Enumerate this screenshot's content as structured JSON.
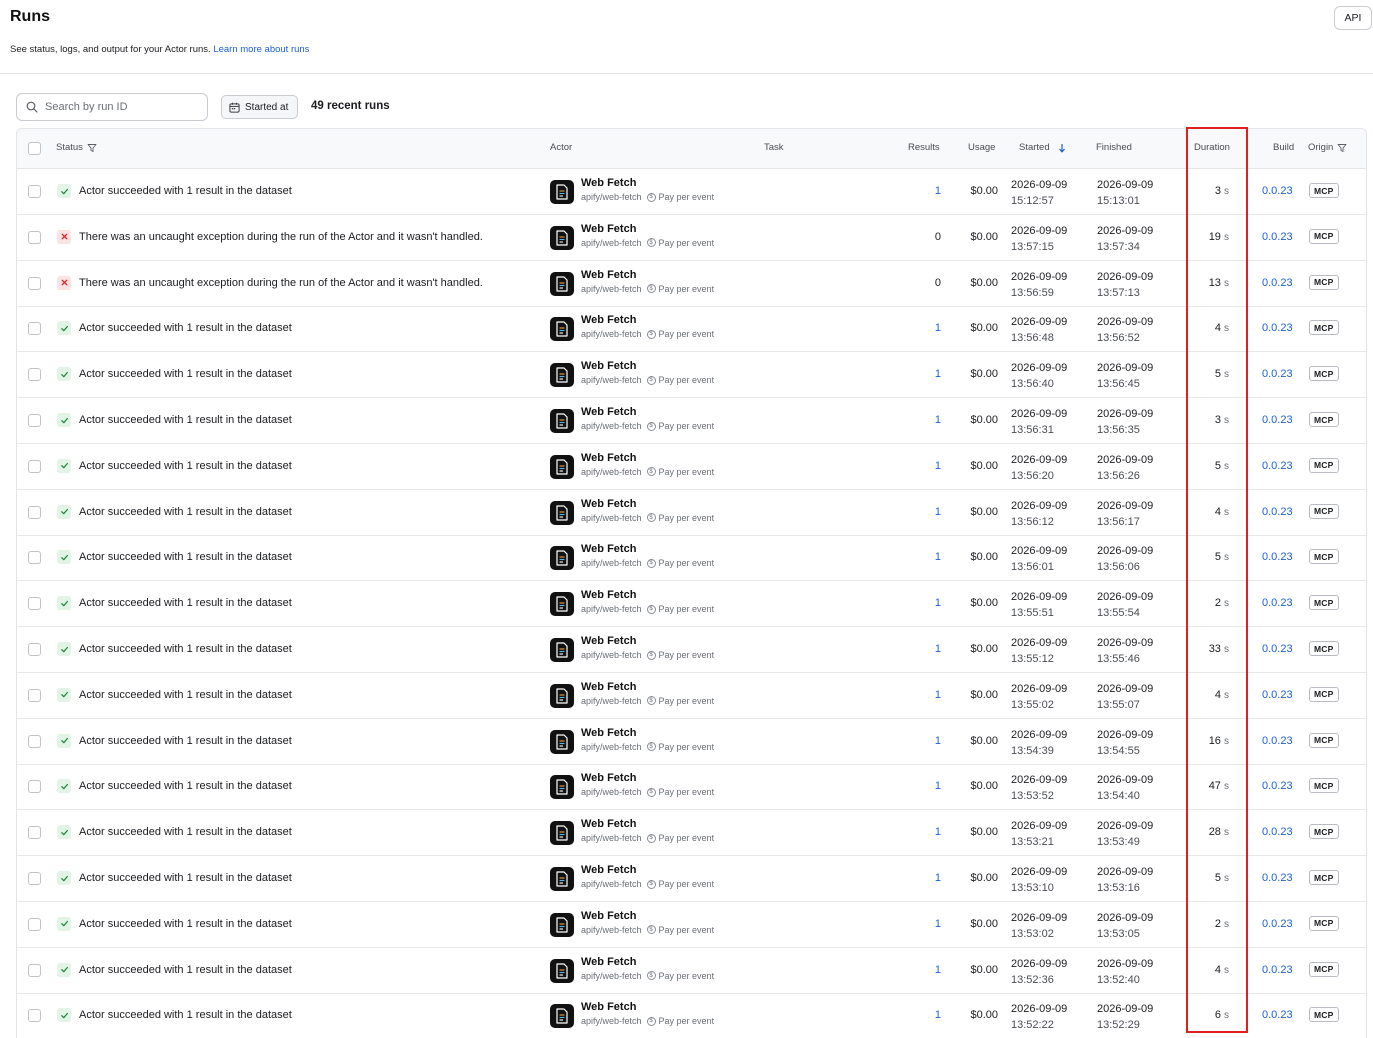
{
  "page": {
    "title": "Runs",
    "subtitle": "See status, logs, and output for your Actor runs.",
    "learn_more": "Learn more about runs",
    "api_label": "API"
  },
  "toolbar": {
    "search_placeholder": "Search by run ID",
    "date_filter_label": "Started at",
    "runs_count": "49 recent runs"
  },
  "columns": {
    "status": "Status",
    "actor": "Actor",
    "task": "Task",
    "results": "Results",
    "usage": "Usage",
    "started": "Started",
    "finished": "Finished",
    "duration": "Duration",
    "build": "Build",
    "origin": "Origin"
  },
  "icons": {
    "search": "search-icon",
    "calendar": "calendar-icon",
    "filter": "filter-icon",
    "sort": "sort-down-arrow-icon",
    "success": "check-icon",
    "failure": "x-icon",
    "actor": "document-icon",
    "pricing": "coin-icon"
  },
  "colors": {
    "link": "#1c5fd6",
    "success_bg": "#e1f4e5",
    "success_fg": "#1f8a3d",
    "error_bg": "#fbe3e3",
    "error_fg": "#d42a2a",
    "highlight": "#e02020"
  },
  "runs": [
    {
      "status": "success",
      "status_text": "Actor succeeded with 1 result in the dataset",
      "actor_name": "Web Fetch",
      "actor_slug": "apify/web-fetch",
      "pricing": "Pay per event",
      "results": "1",
      "usage": "$0.00",
      "started_date": "2026-09-09",
      "started_time": "15:12:57",
      "finished_date": "2026-09-09",
      "finished_time": "15:13:01",
      "duration": "3",
      "duration_unit": "s",
      "build": "0.0.23",
      "origin": "MCP"
    },
    {
      "status": "failed",
      "status_text": "There was an uncaught exception during the run of the Actor and it wasn't handled.",
      "actor_name": "Web Fetch",
      "actor_slug": "apify/web-fetch",
      "pricing": "Pay per event",
      "results": "0",
      "usage": "$0.00",
      "started_date": "2026-09-09",
      "started_time": "13:57:15",
      "finished_date": "2026-09-09",
      "finished_time": "13:57:34",
      "duration": "19",
      "duration_unit": "s",
      "build": "0.0.23",
      "origin": "MCP"
    },
    {
      "status": "failed",
      "status_text": "There was an uncaught exception during the run of the Actor and it wasn't handled.",
      "actor_name": "Web Fetch",
      "actor_slug": "apify/web-fetch",
      "pricing": "Pay per event",
      "results": "0",
      "usage": "$0.00",
      "started_date": "2026-09-09",
      "started_time": "13:56:59",
      "finished_date": "2026-09-09",
      "finished_time": "13:57:13",
      "duration": "13",
      "duration_unit": "s",
      "build": "0.0.23",
      "origin": "MCP"
    },
    {
      "status": "success",
      "status_text": "Actor succeeded with 1 result in the dataset",
      "actor_name": "Web Fetch",
      "actor_slug": "apify/web-fetch",
      "pricing": "Pay per event",
      "results": "1",
      "usage": "$0.00",
      "started_date": "2026-09-09",
      "started_time": "13:56:48",
      "finished_date": "2026-09-09",
      "finished_time": "13:56:52",
      "duration": "4",
      "duration_unit": "s",
      "build": "0.0.23",
      "origin": "MCP"
    },
    {
      "status": "success",
      "status_text": "Actor succeeded with 1 result in the dataset",
      "actor_name": "Web Fetch",
      "actor_slug": "apify/web-fetch",
      "pricing": "Pay per event",
      "results": "1",
      "usage": "$0.00",
      "started_date": "2026-09-09",
      "started_time": "13:56:40",
      "finished_date": "2026-09-09",
      "finished_time": "13:56:45",
      "duration": "5",
      "duration_unit": "s",
      "build": "0.0.23",
      "origin": "MCP"
    },
    {
      "status": "success",
      "status_text": "Actor succeeded with 1 result in the dataset",
      "actor_name": "Web Fetch",
      "actor_slug": "apify/web-fetch",
      "pricing": "Pay per event",
      "results": "1",
      "usage": "$0.00",
      "started_date": "2026-09-09",
      "started_time": "13:56:31",
      "finished_date": "2026-09-09",
      "finished_time": "13:56:35",
      "duration": "3",
      "duration_unit": "s",
      "build": "0.0.23",
      "origin": "MCP"
    },
    {
      "status": "success",
      "status_text": "Actor succeeded with 1 result in the dataset",
      "actor_name": "Web Fetch",
      "actor_slug": "apify/web-fetch",
      "pricing": "Pay per event",
      "results": "1",
      "usage": "$0.00",
      "started_date": "2026-09-09",
      "started_time": "13:56:20",
      "finished_date": "2026-09-09",
      "finished_time": "13:56:26",
      "duration": "5",
      "duration_unit": "s",
      "build": "0.0.23",
      "origin": "MCP"
    },
    {
      "status": "success",
      "status_text": "Actor succeeded with 1 result in the dataset",
      "actor_name": "Web Fetch",
      "actor_slug": "apify/web-fetch",
      "pricing": "Pay per event",
      "results": "1",
      "usage": "$0.00",
      "started_date": "2026-09-09",
      "started_time": "13:56:12",
      "finished_date": "2026-09-09",
      "finished_time": "13:56:17",
      "duration": "4",
      "duration_unit": "s",
      "build": "0.0.23",
      "origin": "MCP"
    },
    {
      "status": "success",
      "status_text": "Actor succeeded with 1 result in the dataset",
      "actor_name": "Web Fetch",
      "actor_slug": "apify/web-fetch",
      "pricing": "Pay per event",
      "results": "1",
      "usage": "$0.00",
      "started_date": "2026-09-09",
      "started_time": "13:56:01",
      "finished_date": "2026-09-09",
      "finished_time": "13:56:06",
      "duration": "5",
      "duration_unit": "s",
      "build": "0.0.23",
      "origin": "MCP"
    },
    {
      "status": "success",
      "status_text": "Actor succeeded with 1 result in the dataset",
      "actor_name": "Web Fetch",
      "actor_slug": "apify/web-fetch",
      "pricing": "Pay per event",
      "results": "1",
      "usage": "$0.00",
      "started_date": "2026-09-09",
      "started_time": "13:55:51",
      "finished_date": "2026-09-09",
      "finished_time": "13:55:54",
      "duration": "2",
      "duration_unit": "s",
      "build": "0.0.23",
      "origin": "MCP"
    },
    {
      "status": "success",
      "status_text": "Actor succeeded with 1 result in the dataset",
      "actor_name": "Web Fetch",
      "actor_slug": "apify/web-fetch",
      "pricing": "Pay per event",
      "results": "1",
      "usage": "$0.00",
      "started_date": "2026-09-09",
      "started_time": "13:55:12",
      "finished_date": "2026-09-09",
      "finished_time": "13:55:46",
      "duration": "33",
      "duration_unit": "s",
      "build": "0.0.23",
      "origin": "MCP"
    },
    {
      "status": "success",
      "status_text": "Actor succeeded with 1 result in the dataset",
      "actor_name": "Web Fetch",
      "actor_slug": "apify/web-fetch",
      "pricing": "Pay per event",
      "results": "1",
      "usage": "$0.00",
      "started_date": "2026-09-09",
      "started_time": "13:55:02",
      "finished_date": "2026-09-09",
      "finished_time": "13:55:07",
      "duration": "4",
      "duration_unit": "s",
      "build": "0.0.23",
      "origin": "MCP"
    },
    {
      "status": "success",
      "status_text": "Actor succeeded with 1 result in the dataset",
      "actor_name": "Web Fetch",
      "actor_slug": "apify/web-fetch",
      "pricing": "Pay per event",
      "results": "1",
      "usage": "$0.00",
      "started_date": "2026-09-09",
      "started_time": "13:54:39",
      "finished_date": "2026-09-09",
      "finished_time": "13:54:55",
      "duration": "16",
      "duration_unit": "s",
      "build": "0.0.23",
      "origin": "MCP"
    },
    {
      "status": "success",
      "status_text": "Actor succeeded with 1 result in the dataset",
      "actor_name": "Web Fetch",
      "actor_slug": "apify/web-fetch",
      "pricing": "Pay per event",
      "results": "1",
      "usage": "$0.00",
      "started_date": "2026-09-09",
      "started_time": "13:53:52",
      "finished_date": "2026-09-09",
      "finished_time": "13:54:40",
      "duration": "47",
      "duration_unit": "s",
      "build": "0.0.23",
      "origin": "MCP"
    },
    {
      "status": "success",
      "status_text": "Actor succeeded with 1 result in the dataset",
      "actor_name": "Web Fetch",
      "actor_slug": "apify/web-fetch",
      "pricing": "Pay per event",
      "results": "1",
      "usage": "$0.00",
      "started_date": "2026-09-09",
      "started_time": "13:53:21",
      "finished_date": "2026-09-09",
      "finished_time": "13:53:49",
      "duration": "28",
      "duration_unit": "s",
      "build": "0.0.23",
      "origin": "MCP"
    },
    {
      "status": "success",
      "status_text": "Actor succeeded with 1 result in the dataset",
      "actor_name": "Web Fetch",
      "actor_slug": "apify/web-fetch",
      "pricing": "Pay per event",
      "results": "1",
      "usage": "$0.00",
      "started_date": "2026-09-09",
      "started_time": "13:53:10",
      "finished_date": "2026-09-09",
      "finished_time": "13:53:16",
      "duration": "5",
      "duration_unit": "s",
      "build": "0.0.23",
      "origin": "MCP"
    },
    {
      "status": "success",
      "status_text": "Actor succeeded with 1 result in the dataset",
      "actor_name": "Web Fetch",
      "actor_slug": "apify/web-fetch",
      "pricing": "Pay per event",
      "results": "1",
      "usage": "$0.00",
      "started_date": "2026-09-09",
      "started_time": "13:53:02",
      "finished_date": "2026-09-09",
      "finished_time": "13:53:05",
      "duration": "2",
      "duration_unit": "s",
      "build": "0.0.23",
      "origin": "MCP"
    },
    {
      "status": "success",
      "status_text": "Actor succeeded with 1 result in the dataset",
      "actor_name": "Web Fetch",
      "actor_slug": "apify/web-fetch",
      "pricing": "Pay per event",
      "results": "1",
      "usage": "$0.00",
      "started_date": "2026-09-09",
      "started_time": "13:52:36",
      "finished_date": "2026-09-09",
      "finished_time": "13:52:40",
      "duration": "4",
      "duration_unit": "s",
      "build": "0.0.23",
      "origin": "MCP"
    },
    {
      "status": "success",
      "status_text": "Actor succeeded with 1 result in the dataset",
      "actor_name": "Web Fetch",
      "actor_slug": "apify/web-fetch",
      "pricing": "Pay per event",
      "results": "1",
      "usage": "$0.00",
      "started_date": "2026-09-09",
      "started_time": "13:52:22",
      "finished_date": "2026-09-09",
      "finished_time": "13:52:29",
      "duration": "6",
      "duration_unit": "s",
      "build": "0.0.23",
      "origin": "MCP"
    }
  ]
}
